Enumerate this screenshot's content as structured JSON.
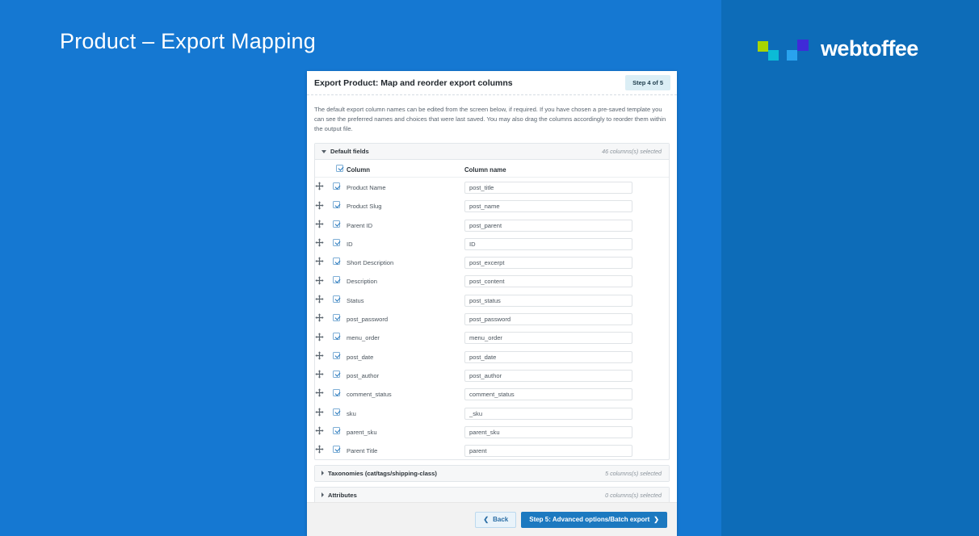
{
  "slide": {
    "title": "Product  –  Export Mapping",
    "brand": {
      "name": "webtoffee",
      "mark_colors": [
        "#a8d500",
        "#0bbbd6",
        "#29a3ee",
        "#3f2ad8"
      ]
    },
    "background_color": "#1578d2",
    "band_color": "#0d6cb8"
  },
  "card": {
    "header": {
      "title": "Export Product: Map and reorder export columns",
      "step_badge": "Step 4 of 5"
    },
    "intro": "The default export column names can be edited from the screen below, if required. If you have chosen a pre-saved template you can see the preferred names and choices that were last saved. You may also drag the columns accordingly to reorder them within the output file.",
    "default_fields": {
      "label": "Default fields",
      "count": "46 columns(s) selected",
      "expanded": true,
      "table": {
        "headers": {
          "column": "Column",
          "column_name": "Column name"
        },
        "select_all_checked": true,
        "rows": [
          {
            "column": "Product Name",
            "column_name": "post_title",
            "checked": true
          },
          {
            "column": "Product Slug",
            "column_name": "post_name",
            "checked": true
          },
          {
            "column": "Parent ID",
            "column_name": "post_parent",
            "checked": true
          },
          {
            "column": "ID",
            "column_name": "ID",
            "checked": true
          },
          {
            "column": "Short Description",
            "column_name": "post_excerpt",
            "checked": true
          },
          {
            "column": "Description",
            "column_name": "post_content",
            "checked": true
          },
          {
            "column": "Status",
            "column_name": "post_status",
            "checked": true
          },
          {
            "column": "post_password",
            "column_name": "post_password",
            "checked": true
          },
          {
            "column": "menu_order",
            "column_name": "menu_order",
            "checked": true
          },
          {
            "column": "post_date",
            "column_name": "post_date",
            "checked": true
          },
          {
            "column": "post_author",
            "column_name": "post_author",
            "checked": true
          },
          {
            "column": "comment_status",
            "column_name": "comment_status",
            "checked": true
          },
          {
            "column": "sku",
            "column_name": "_sku",
            "checked": true
          },
          {
            "column": "parent_sku",
            "column_name": "parent_sku",
            "checked": true
          },
          {
            "column": "Parent Title",
            "column_name": "parent",
            "checked": true
          }
        ]
      }
    },
    "taxonomies": {
      "label": "Taxonomies (cat/tags/shipping-class)",
      "count": "5 columns(s) selected",
      "expanded": false
    },
    "attributes": {
      "label": "Attributes",
      "count": "0 columns(s) selected",
      "expanded": false
    },
    "footer": {
      "back_label": "Back",
      "next_label": "Step 5: Advanced options/Batch export"
    }
  }
}
